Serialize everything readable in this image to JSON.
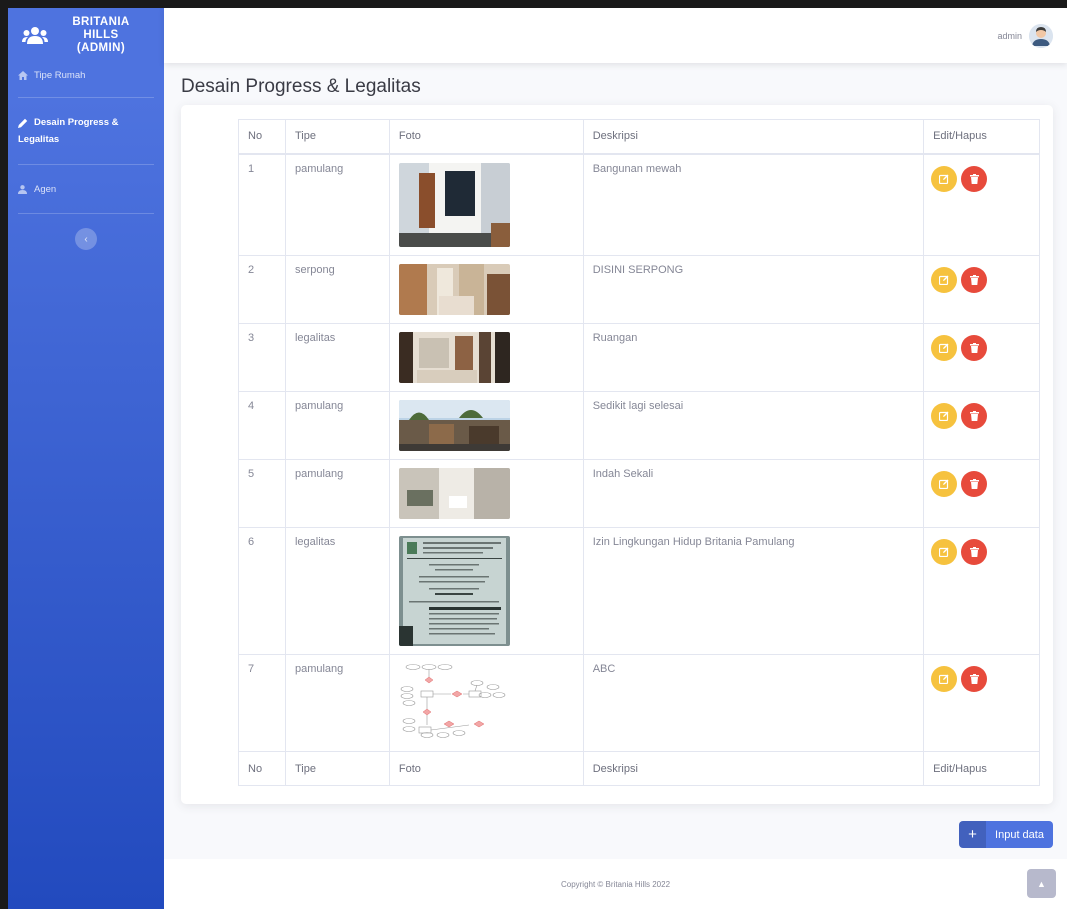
{
  "brand": {
    "title": "BRITANIA HILLS (ADMIN)",
    "line1": "BRITANIA",
    "line2": "HILLS",
    "line3": "(ADMIN)",
    "icon": "users-icon"
  },
  "sidebar": {
    "items": [
      {
        "label": "Tipe Rumah",
        "icon": "home-icon",
        "active": false
      },
      {
        "label": "Desain Progress & Legalitas",
        "line1": "Desain Progress &",
        "line2": "Legalitas",
        "icon": "pencil-icon",
        "active": true
      },
      {
        "label": "Agen",
        "icon": "user-icon",
        "active": false
      }
    ],
    "toggle_icon": "chevron-left-icon"
  },
  "topbar": {
    "user": "admin"
  },
  "page": {
    "title": "Desain Progress & Legalitas"
  },
  "table": {
    "columns": [
      "No",
      "Tipe",
      "Foto",
      "Deskripsi",
      "Edit/Hapus"
    ],
    "rows": [
      {
        "no": "1",
        "tipe": "pamulang",
        "deskripsi": "Bangunan mewah",
        "photo": "house-facade-photo"
      },
      {
        "no": "2",
        "tipe": "serpong",
        "deskripsi": "DISINI SERPONG",
        "photo": "interior-photo"
      },
      {
        "no": "3",
        "tipe": "legalitas",
        "deskripsi": "Ruangan",
        "photo": "room-photo"
      },
      {
        "no": "4",
        "tipe": "pamulang",
        "deskripsi": "Sedikit lagi selesai",
        "photo": "construction-photo"
      },
      {
        "no": "5",
        "tipe": "pamulang",
        "deskripsi": "Indah Sekali",
        "photo": "bathroom-photo"
      },
      {
        "no": "6",
        "tipe": "legalitas",
        "deskripsi": "Izin Lingkungan Hidup Britania Pamulang",
        "photo": "document-photo"
      },
      {
        "no": "7",
        "tipe": "pamulang",
        "deskripsi": "ABC",
        "photo": "er-diagram-image"
      }
    ]
  },
  "actions": {
    "input_label": "Input data"
  },
  "footer": {
    "copyright": "Copyright © Britania Hills 2022"
  },
  "colors": {
    "primary": "#4e73df",
    "warning": "#f6c23e",
    "danger": "#e74a3b"
  }
}
